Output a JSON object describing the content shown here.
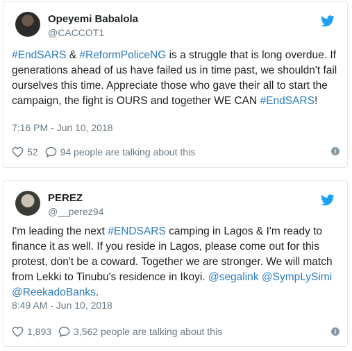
{
  "tweets": [
    {
      "name": "Opeyemi Babalola",
      "handle": "@CACCOT1",
      "body": {
        "h1": "#EndSARS",
        "t1": " & ",
        "h2": "#ReformPoliceNG",
        "t2": " is a struggle that is long overdue. If generations ahead of us have failed us in time past, we shouldn't fail ourselves this time. Appreciate those who gave their all to start the campaign, the fight is OURS and together WE CAN ",
        "h3": "#EndSARS",
        "t3": "!"
      },
      "time": "7:16 PM - Jun 10, 2018",
      "likes": "52",
      "talking": "94 people are talking about this"
    },
    {
      "name": "PEREZ",
      "handle": "@__perez94",
      "body": {
        "t1": "I'm leading the next ",
        "h1": "#ENDSARS",
        "t2": " camping in Lagos & I'm ready to finance it as well. If you reside in Lagos, please come out for this protest, don't be a coward. Together we are stronger. We will match from Lekki to Tinubu's residence in Ikoyi. ",
        "m1": "@segalink",
        "t3": " ",
        "m2": "@SympLySimi",
        "t4": " ",
        "m3": "@ReekadoBanks",
        "t5": "."
      },
      "time": "8:49 AM - Jun 10, 2018",
      "likes": "1,893",
      "talking": "3,562 people are talking about this"
    }
  ],
  "icons": {
    "logo": "twitter-bird-icon",
    "like": "heart-icon",
    "reply": "speech-bubble-icon",
    "info": "info-icon"
  },
  "colors": {
    "link": "#2b7bb9",
    "twitter_blue": "#1da1f2",
    "muted": "#697882",
    "border": "#e1e8ed"
  }
}
